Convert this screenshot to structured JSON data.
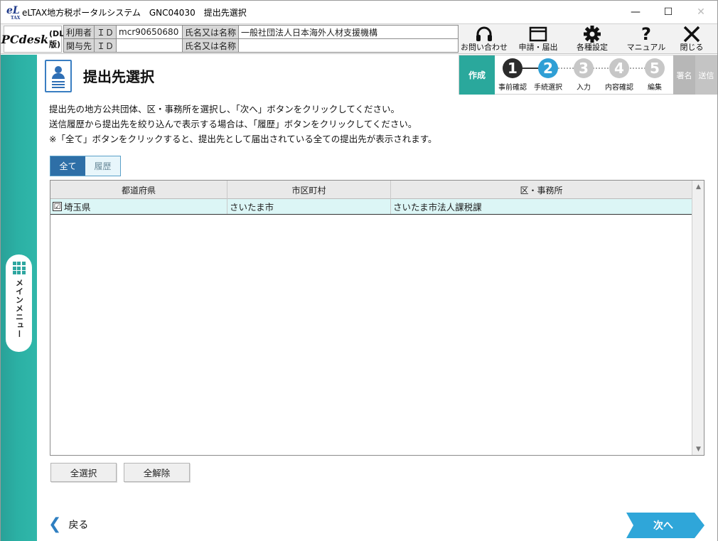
{
  "window": {
    "title": "eLTAX地方税ポータルシステム　GNC04030　提出先選択",
    "logo_main": "eL",
    "logo_sub": "TAX"
  },
  "header": {
    "product_name": "PCdesk",
    "product_suffix": "(DL版)",
    "user": {
      "label": "利用者",
      "id_label": "ＩＤ",
      "id_value": "mcr90650680",
      "name_label": "氏名又は名称",
      "name_value": "一般社団法人日本海外人材支援機構"
    },
    "agent": {
      "label": "関与先",
      "id_label": "ＩＤ",
      "id_value": "",
      "name_label": "氏名又は名称",
      "name_value": ""
    },
    "buttons": [
      {
        "label": "お問い合わせ",
        "icon": "headset-icon"
      },
      {
        "label": "申請・届出",
        "icon": "window-icon"
      },
      {
        "label": "各種設定",
        "icon": "gear-icon"
      },
      {
        "label": "マニュアル",
        "icon": "question-icon"
      },
      {
        "label": "閉じる",
        "icon": "close-icon"
      }
    ]
  },
  "side": {
    "menu_label": "メインメニュー"
  },
  "page": {
    "title": "提出先選択",
    "description": [
      "提出先の地方公共団体、区・事務所を選択し、「次へ」ボタンをクリックしてください。",
      "送信履歴から提出先を絞り込んで表示する場合は、「履歴」ボタンをクリックしてください。",
      "※「全て」ボタンをクリックすると、提出先として届出されている全ての提出先が表示されます。"
    ]
  },
  "steps": {
    "create_label": "作成",
    "items": [
      {
        "num": "1",
        "label": "事前確認",
        "state": "done"
      },
      {
        "num": "2",
        "label": "手続選択",
        "state": "current"
      },
      {
        "num": "3",
        "label": "入力",
        "state": "todo"
      },
      {
        "num": "4",
        "label": "内容確認",
        "state": "todo"
      },
      {
        "num": "5",
        "label": "編集",
        "state": "todo"
      }
    ],
    "sign_label": "署名",
    "send_label": "送信"
  },
  "tabs": {
    "all": "全て",
    "history": "履歴",
    "active": "all"
  },
  "table": {
    "columns": [
      "都道府県",
      "市区町村",
      "区・事務所"
    ],
    "rows": [
      {
        "checked": true,
        "check_mark": "☑",
        "prefecture": "埼玉県",
        "city": "さいたま市",
        "office": "さいたま市法人課税課"
      }
    ]
  },
  "actions": {
    "select_all": "全選択",
    "deselect_all": "全解除",
    "back": "戻る",
    "next": "次へ"
  },
  "colors": {
    "accent_teal": "#2aa89c",
    "current_step": "#2f9fd5",
    "selected_row": "#dcf6f6",
    "next_button": "#2fa6d9"
  }
}
